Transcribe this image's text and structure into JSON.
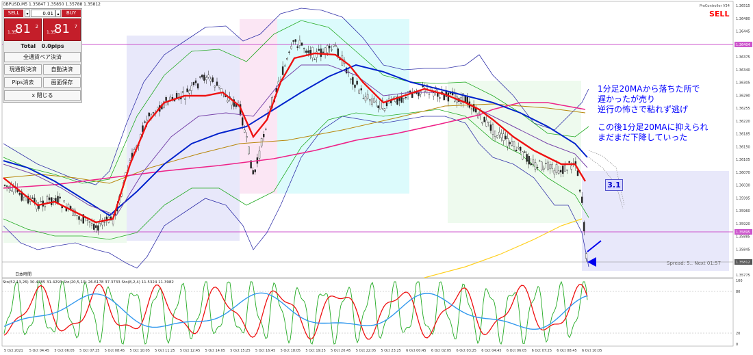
{
  "chart_header": {
    "symbol_line": "GBPUSD,M5  1.35847 1.35850 1.35788 1.35812"
  },
  "trade_panel": {
    "sell_label": "SELL",
    "buy_label": "BUY",
    "lot_value": "0.01",
    "sell_price_prefix": "1.35",
    "sell_price_big": "81",
    "sell_price_sup": "2",
    "buy_price_prefix": "1.35",
    "buy_price_big": "81",
    "buy_price_sup": "7",
    "total_label": "Total",
    "total_value": "0.0pips",
    "close_all_label": "全通貨ペア決済",
    "close_current_label": "現通貨決済",
    "auto_close_label": "自動決済",
    "pips_clear_label": "Pips消去",
    "screen_save_label": "画面保存",
    "close_panel_label": "x 閉じる"
  },
  "signal": {
    "label": "SELL",
    "ea_name": "ProController V34"
  },
  "annotation": {
    "line1": "1分足20MAから落ちた所で",
    "line2": "遅かったが売り",
    "line3": "逆行の怖さで粘れず逃げ",
    "line4": "この後1分足20MAに抑えられ",
    "line5": "まだまだ下降していった",
    "badge": "3.1"
  },
  "spread_text": "Spread: 5.. Next 01:57",
  "timezone_label": "日本時間",
  "stochastic_label": "Sto(52,13,26) 30.4785 31.4293  Sto(20,5,10) 26.6178 37.3733  Sto(8,2,4) 11.5324 11.3982",
  "price_axis": [
    "1.36515",
    "1.36480",
    "1.36445",
    "1.36410",
    "1.36375",
    "1.36340",
    "1.36305",
    "1.36290",
    "1.36255",
    "1.36220",
    "1.36185",
    "1.36150",
    "1.36105",
    "1.36070",
    "1.36030",
    "1.35995",
    "1.35960",
    "1.35920",
    "1.35885",
    "1.35845",
    "1.35810",
    "1.35775"
  ],
  "price_markers": {
    "upper_line": "1.36404",
    "lower_line": "1.35895",
    "current": "1.35812"
  },
  "stoch_axis": [
    "100",
    "80",
    "20",
    "0"
  ],
  "time_axis": [
    "5 Oct 2021",
    "5 Oct 04:45",
    "5 Oct 06:05",
    "5 Oct 07:25",
    "5 Oct 08:45",
    "5 Oct 10:05",
    "5 Oct 11:25",
    "5 Oct 12:45",
    "5 Oct 14:05",
    "5 Oct 15:25",
    "5 Oct 16:45",
    "5 Oct 18:05",
    "5 Oct 19:25",
    "5 Oct 20:45",
    "5 Oct 22:05",
    "5 Oct 23:25",
    "6 Oct 00:45",
    "6 Oct 02:05",
    "6 Oct 03:25",
    "6 Oct 04:45",
    "6 Oct 06:05",
    "6 Oct 07:25",
    "6 Oct 08:45",
    "6 Oct 10:05"
  ],
  "colors": {
    "sell_red": "#c41e2a",
    "annotation_blue": "#0000ff",
    "sell_signal": "#ff0000"
  }
}
